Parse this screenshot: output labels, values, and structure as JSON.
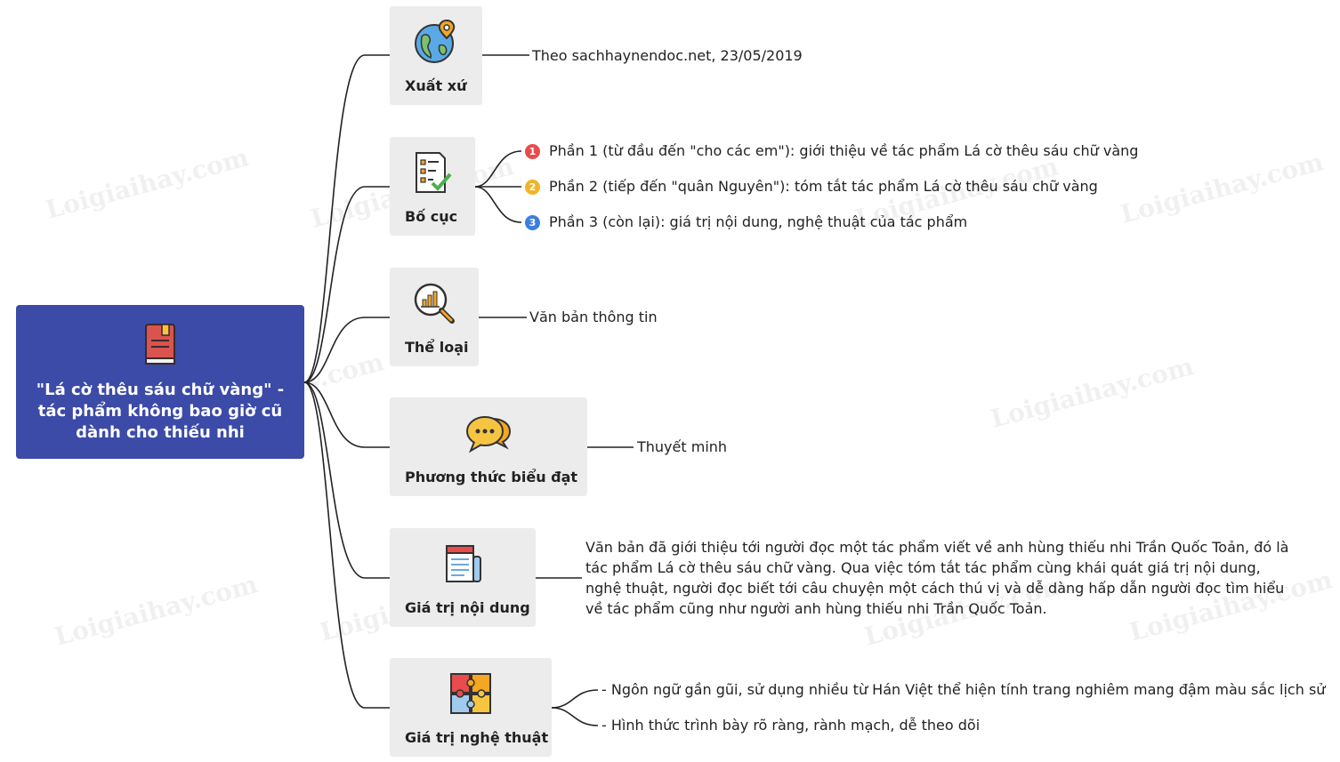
{
  "root": {
    "title_lines": [
      "\"Lá cờ thêu sáu chữ vàng\" -",
      "tác phẩm không bao giờ cũ",
      "dành cho thiếu nhi"
    ],
    "icon": "book-icon",
    "color": "#3c4aa8"
  },
  "branches": {
    "xuat_xu": {
      "label": "Xuất xứ",
      "icon": "globe-pin-icon",
      "text": "Theo sachhaynendoc.net, 23/05/2019"
    },
    "bo_cuc": {
      "label": "Bố cục",
      "icon": "checklist-icon",
      "items": [
        {
          "badge": "1",
          "text": "Phần 1 (từ đầu đến \"cho các em\"): giới thiệu về tác phẩm Lá cờ thêu sáu chữ vàng",
          "color": "#e84c4c"
        },
        {
          "badge": "2",
          "text": "Phần 2 (tiếp đến \"quân Nguyên\"): tóm tắt tác phẩm Lá cờ thêu sáu chữ vàng",
          "color": "#f2b32a"
        },
        {
          "badge": "3",
          "text": "Phần 3 (còn lại): giá trị nội dung, nghệ thuật của tác phẩm",
          "color": "#3a7fe0"
        }
      ]
    },
    "the_loai": {
      "label": "Thể loại",
      "icon": "magnifier-chart-icon",
      "text": "Văn bản thông tin"
    },
    "phuong_thuc": {
      "label": "Phương thức biểu đạt",
      "icon": "chat-bubbles-icon",
      "text": "Thuyết minh"
    },
    "gia_tri_noi_dung": {
      "label": "Giá trị nội dung",
      "icon": "document-icon",
      "text": "Văn bản đã giới thiệu tới người đọc một tác phẩm viết về anh hùng thiếu nhi Trần Quốc Toản, đó là tác phẩm Lá cờ thêu sáu chữ vàng. Qua việc tóm tắt tác phẩm cùng khái quát giá trị nội dung, nghệ thuật, người đọc biết tới câu chuyện một cách thú vị và dễ dàng hấp dẫn người đọc tìm hiểu về tác phẩm cũng như người anh hùng thiếu nhi Trần Quốc Toản."
    },
    "gia_tri_nghe_thuat": {
      "label": "Giá trị nghệ thuật",
      "icon": "puzzle-icon",
      "items": [
        "- Ngôn ngữ gần gũi, sử dụng nhiều từ Hán Việt thể hiện tính trang nghiêm mang đậm màu sắc lịch sử",
        "- Hình thức trình bày rõ ràng, rành mạch, dễ theo dõi"
      ]
    }
  },
  "watermark": "Loigiaihay.com"
}
